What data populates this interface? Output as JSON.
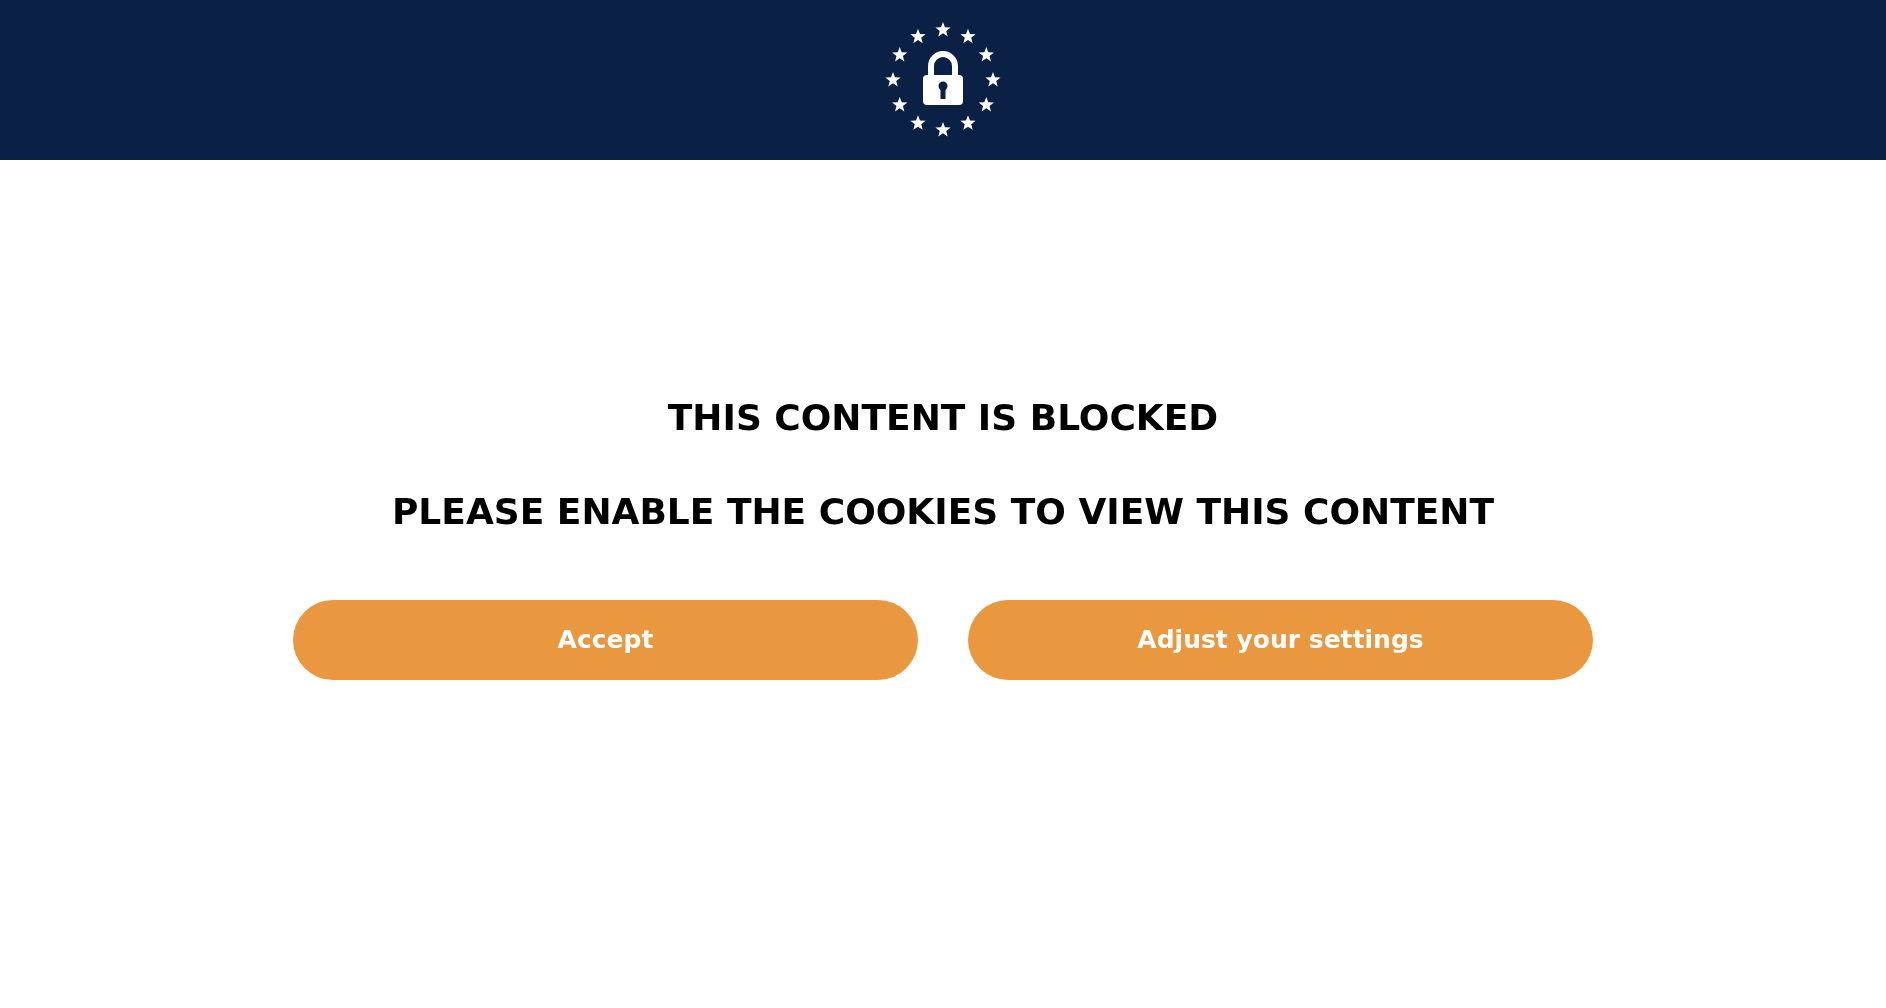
{
  "header": {
    "kind": "logo"
  },
  "message": {
    "title": "THIS CONTENT IS BLOCKED",
    "subtitle": "PLEASE ENABLE THE COOKIES TO VIEW THIS CONTENT"
  },
  "buttons": [
    {
      "label": "Accept"
    },
    {
      "label": "Adjust your settings"
    }
  ]
}
